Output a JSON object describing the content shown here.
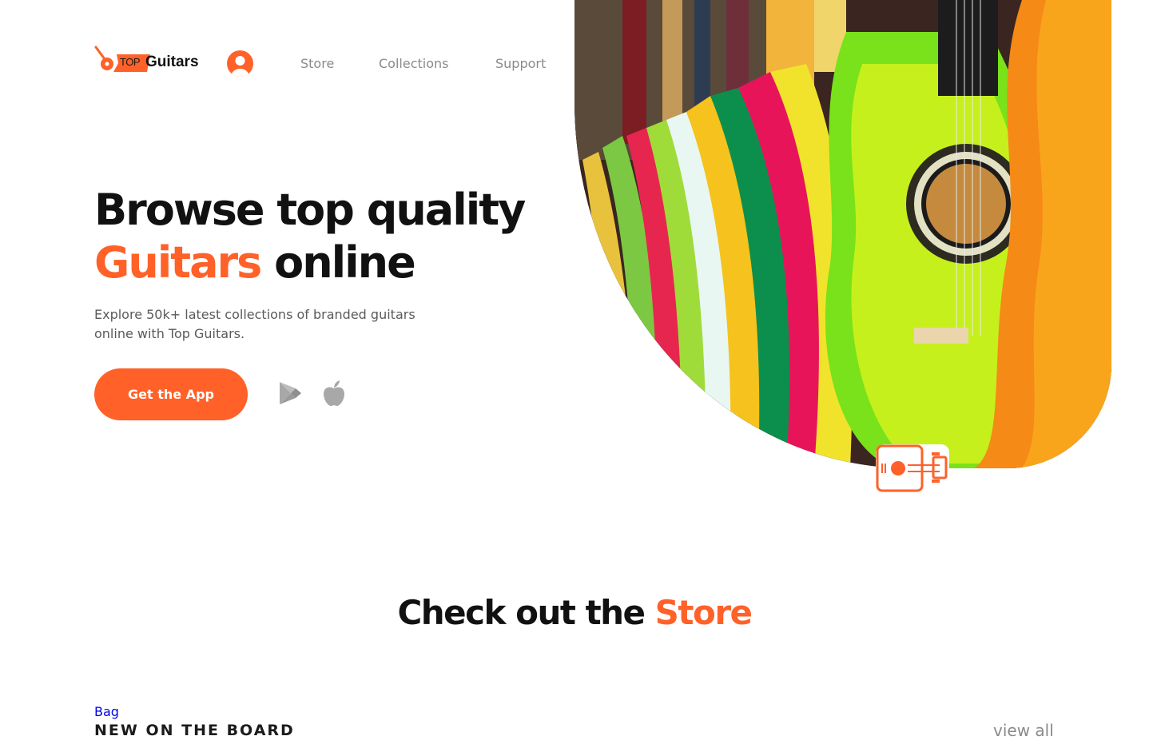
{
  "header": {
    "logo_small": "TOP",
    "logo_name": "Guitars",
    "avatar_icon": "user-icon",
    "nav": [
      {
        "label": "Store"
      },
      {
        "label": "Collections"
      },
      {
        "label": "Support"
      }
    ]
  },
  "hero": {
    "title_line1": "Browse top quality",
    "title_accent": "Guitars",
    "title_rest": " online",
    "subtitle": "Explore 50k+ latest collections of branded guitars online with Top Guitars.",
    "cta_label": "Get the App",
    "store_icons": [
      "google-play-icon",
      "apple-icon"
    ],
    "badge_icon": "guitar-icon"
  },
  "store_section": {
    "title_main": "Check out the ",
    "title_accent": "Store",
    "bag_link": "Bag",
    "board_title": "NEW ON THE BOARD",
    "view_all": "view all"
  },
  "colors": {
    "accent": "#ff6128",
    "text_dark": "#111111",
    "text_muted": "#8a8a8a",
    "link": "#0000ee"
  }
}
